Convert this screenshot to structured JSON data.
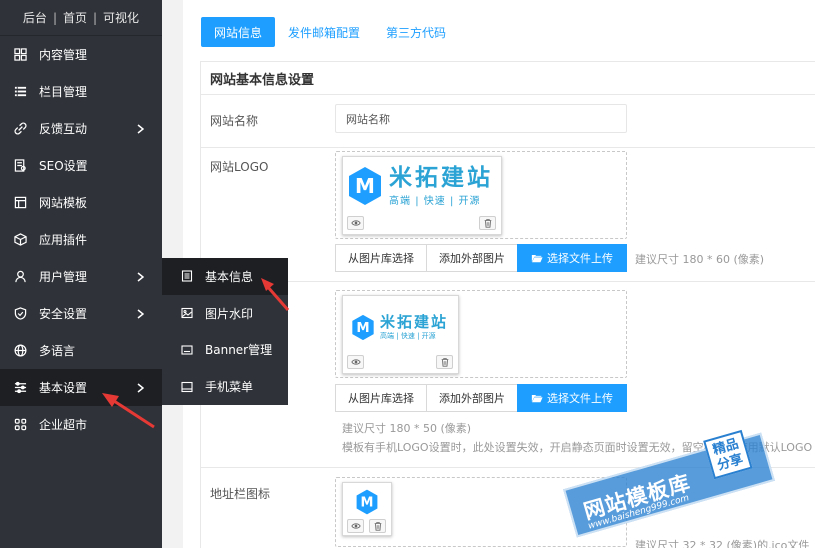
{
  "sidebar": {
    "top_links": [
      "后台",
      "首页",
      "可视化"
    ],
    "separator": "|",
    "items": [
      {
        "label": "内容管理",
        "icon": "grid-icon",
        "has_arrow": false
      },
      {
        "label": "栏目管理",
        "icon": "list-icon",
        "has_arrow": false
      },
      {
        "label": "反馈互动",
        "icon": "link-icon",
        "has_arrow": true
      },
      {
        "label": "SEO设置",
        "icon": "document-seo-icon",
        "has_arrow": false
      },
      {
        "label": "网站模板",
        "icon": "template-icon",
        "has_arrow": false
      },
      {
        "label": "应用插件",
        "icon": "cube-icon",
        "has_arrow": false
      },
      {
        "label": "用户管理",
        "icon": "user-icon",
        "has_arrow": true
      },
      {
        "label": "安全设置",
        "icon": "shield-icon",
        "has_arrow": true
      },
      {
        "label": "多语言",
        "icon": "globe-icon",
        "has_arrow": false
      },
      {
        "label": "基本设置",
        "icon": "sliders-icon",
        "has_arrow": true,
        "active": true
      },
      {
        "label": "企业超市",
        "icon": "puzzle-icon",
        "has_arrow": false
      }
    ]
  },
  "submenu": {
    "items": [
      {
        "label": "基本信息",
        "icon": "document-icon",
        "active": true
      },
      {
        "label": "图片水印",
        "icon": "image-icon"
      },
      {
        "label": "Banner管理",
        "icon": "banner-icon"
      },
      {
        "label": "手机菜单",
        "icon": "mobile-menu-icon"
      }
    ]
  },
  "tabs": [
    "网站信息",
    "发件邮箱配置",
    "第三方代码"
  ],
  "form": {
    "title": "网站基本信息设置",
    "site_name_label": "网站名称",
    "site_name_value": "网站名称",
    "logo_label": "网站LOGO",
    "favicon_label": "地址栏图标",
    "btn_library": "从图片库选择",
    "btn_external": "添加外部图片",
    "btn_upload": "选择文件上传",
    "logo_hint": "建议尺寸 180 * 60 (像素)",
    "mobile_logo_hint": "建议尺寸 180 * 50 (像素)",
    "mobile_logo_note": "模板有手机LOGO设置时，此处设置失效，开启静态页面时设置无效，留空手机端使用默认LOGO",
    "favicon_hint": "建议尺寸 32 * 32 (像素)的.ico文件"
  },
  "logo": {
    "brand": "米拓建站",
    "tagline": [
      "高端",
      "快速",
      "开源"
    ],
    "tagline_sep": "|",
    "mark": "M"
  },
  "watermark": {
    "title": "网站模板库",
    "url": "www.baisheng999.com",
    "badge": [
      "精品",
      "分享"
    ]
  },
  "colors": {
    "sidebar_bg": "#2f3238",
    "sidebar_active": "#1d1f23",
    "primary": "#1e9fff",
    "brand": "#2ba3d4",
    "annotation_arrow": "#e53935"
  }
}
